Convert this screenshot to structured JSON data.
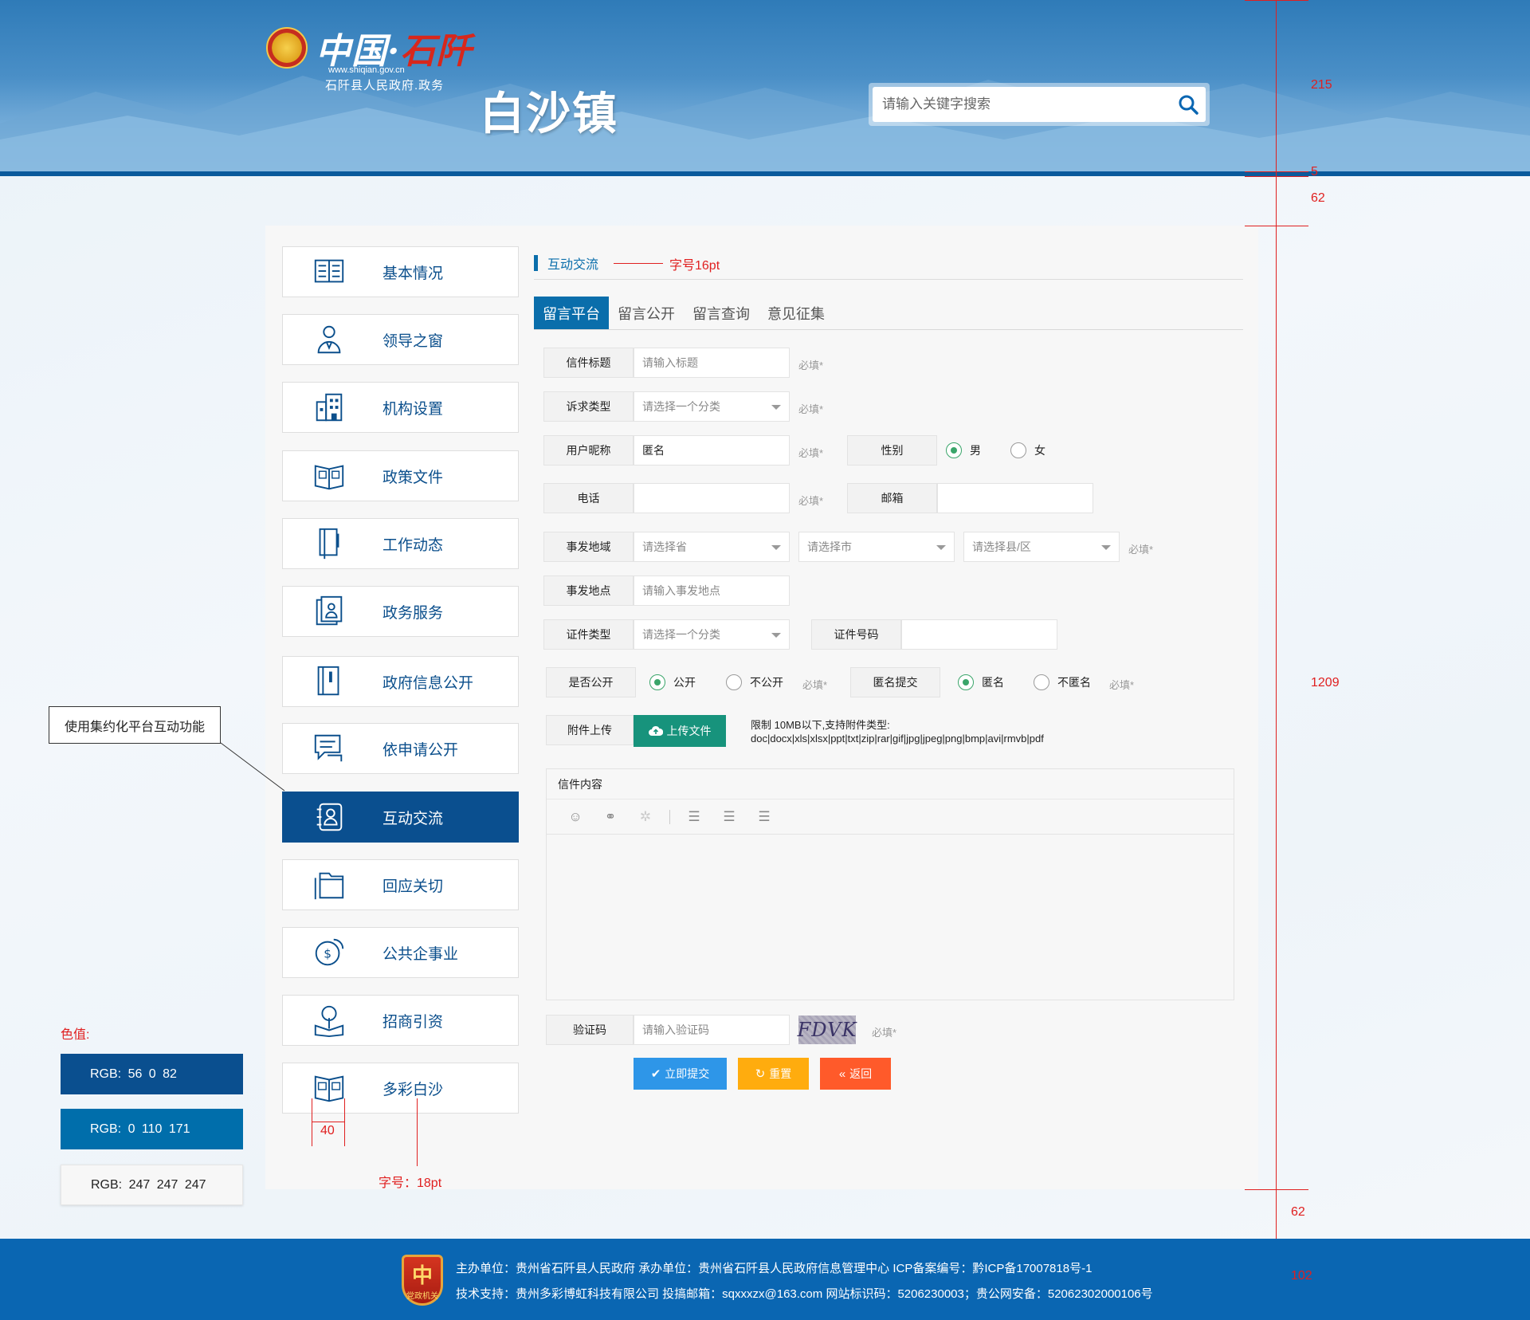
{
  "header": {
    "logo_prefix": "中国·",
    "logo_name": "石阡",
    "logo_url": "www.shiqian.gov.cn",
    "logo_subtitle": "石阡县人民政府.政务",
    "town_name": "白沙镇",
    "search_placeholder": "请输入关键字搜索"
  },
  "sidebar": {
    "items": [
      {
        "label": "基本情况",
        "icon": "book-list-icon"
      },
      {
        "label": "领导之窗",
        "icon": "person-icon"
      },
      {
        "label": "机构设置",
        "icon": "building-icon"
      },
      {
        "label": "政策文件",
        "icon": "open-book-icon"
      },
      {
        "label": "工作动态",
        "icon": "notebook-icon"
      },
      {
        "label": "政务服务",
        "icon": "service-icon"
      },
      {
        "label": "政府信息公开",
        "icon": "document-icon"
      },
      {
        "label": "依申请公开",
        "icon": "chat-icon"
      },
      {
        "label": "互动交流",
        "icon": "contact-book-icon",
        "active": true
      },
      {
        "label": "回应关切",
        "icon": "folder-icon"
      },
      {
        "label": "公共企事业",
        "icon": "money-icon"
      },
      {
        "label": "招商引资",
        "icon": "tree-book-icon"
      },
      {
        "label": "多彩白沙",
        "icon": "photo-book-icon"
      }
    ]
  },
  "content": {
    "section_title": "互动交流",
    "tabs": [
      "留言平台",
      "留言公开",
      "留言查询",
      "意见征集"
    ],
    "active_tab": 0,
    "required": "必填*",
    "form": {
      "title_label": "信件标题",
      "title_placeholder": "请输入标题",
      "type_label": "诉求类型",
      "type_placeholder": "请选择一个分类",
      "nick_label": "用户昵称",
      "nick_value": "匿名",
      "gender_label": "性别",
      "gender_male": "男",
      "gender_female": "女",
      "phone_label": "电话",
      "email_label": "邮箱",
      "region_label": "事发地域",
      "province_placeholder": "请选择省",
      "city_placeholder": "请选择市",
      "county_placeholder": "请选择县/区",
      "place_label": "事发地点",
      "place_placeholder": "请输入事发地点",
      "id_type_label": "证件类型",
      "id_type_placeholder": "请选择一个分类",
      "id_number_label": "证件号码",
      "public_label": "是否公开",
      "public_yes": "公开",
      "public_no": "不公开",
      "anon_label": "匿名提交",
      "anon_yes": "匿名",
      "anon_no": "不匿名",
      "attach_label": "附件上传",
      "upload_button": "上传文件",
      "upload_note_1": "限制 10MB以下,支持附件类型:",
      "upload_note_2": "doc|docx|xls|xlsx|ppt|txt|zip|rar|gif|jpg|jpeg|png|bmp|avi|rmvb|pdf",
      "content_label": "信件内容",
      "captcha_label": "验证码",
      "captcha_placeholder": "请输入验证码",
      "captcha_text": "FDVK",
      "submit": "立即提交",
      "reset": "重置",
      "back": "返回"
    }
  },
  "annotations": {
    "title_font": "字号16pt",
    "nav_font": "字号：18pt",
    "icon_width": "40",
    "callout": "使用集约化平台互动功能",
    "color_title": "色值:",
    "colors": [
      {
        "text": "RGB:  56    0    82",
        "bg": "#0a4f8f",
        "fg": "#ffffff"
      },
      {
        "text": "RGB:  0   110   171",
        "bg": "#006eab",
        "fg": "#ffffff"
      },
      {
        "text": "RGB:  247  247  247",
        "bg": "#f7f7f7",
        "fg": "#222222"
      }
    ],
    "dim_215": "215",
    "dim_5": "5",
    "dim_62_top": "62",
    "dim_1209": "1209",
    "dim_62_bottom": "62",
    "dim_102": "102"
  },
  "footer": {
    "badge_top": "中",
    "badge_bottom": "党政机关",
    "line1": "主办单位：贵州省石阡县人民政府 承办单位：贵州省石阡县人民政府信息管理中心 ICP备案编号：黔ICP备17007818号-1",
    "line2": "技术支持：贵州多彩博虹科技有限公司 投搞邮箱：sqxxxzx@163.com 网站标识码：5206230003；贵公网安备：52062302000106号"
  }
}
